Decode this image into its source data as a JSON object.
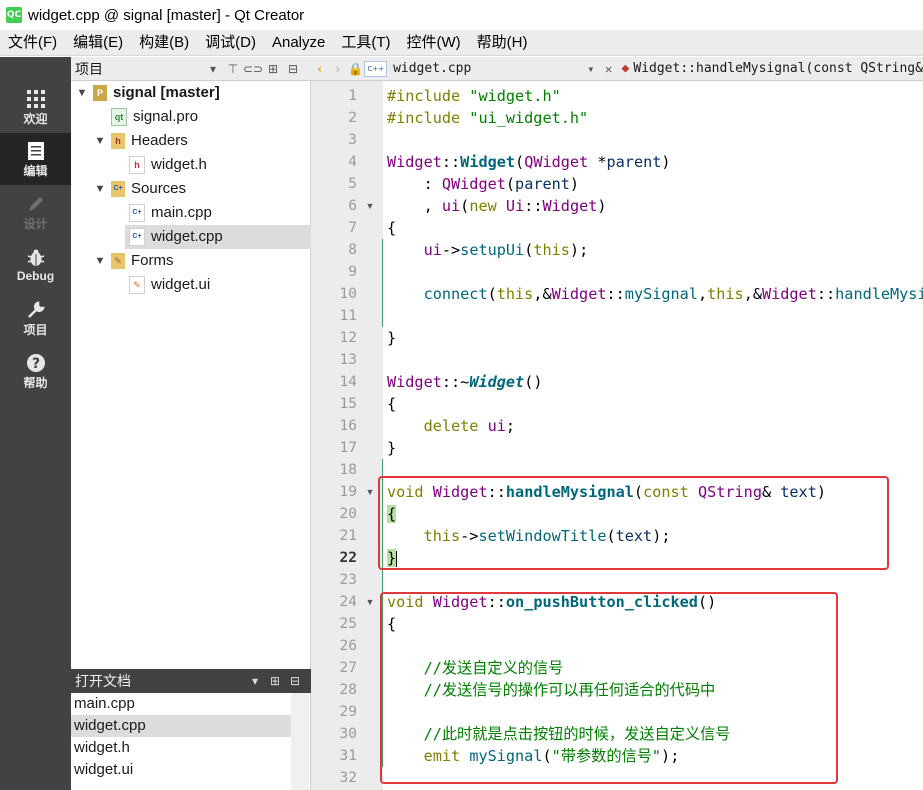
{
  "window": {
    "title": "widget.cpp @ signal [master] - Qt Creator",
    "app_icon": "QC"
  },
  "menu": [
    "文件(F)",
    "编辑(E)",
    "构建(B)",
    "调试(D)",
    "Analyze",
    "工具(T)",
    "控件(W)",
    "帮助(H)"
  ],
  "modes": [
    {
      "label": "欢迎",
      "icon": "grid-icon"
    },
    {
      "label": "编辑",
      "icon": "document-icon"
    },
    {
      "label": "设计",
      "icon": "pencil-icon"
    },
    {
      "label": "Debug",
      "icon": "bug-icon"
    },
    {
      "label": "项目",
      "icon": "wrench-icon"
    },
    {
      "label": "帮助",
      "icon": "help-icon"
    }
  ],
  "project_panel": {
    "title": "项目",
    "tree": [
      {
        "label": "signal [master]",
        "level": 0,
        "expanded": true,
        "type": "project"
      },
      {
        "label": "signal.pro",
        "level": 1,
        "type": "pro"
      },
      {
        "label": "Headers",
        "level": 1,
        "expanded": true,
        "type": "folder-h"
      },
      {
        "label": "widget.h",
        "level": 2,
        "type": "header"
      },
      {
        "label": "Sources",
        "level": 1,
        "expanded": true,
        "type": "folder-cpp"
      },
      {
        "label": "main.cpp",
        "level": 2,
        "type": "cpp"
      },
      {
        "label": "widget.cpp",
        "level": 2,
        "type": "cpp",
        "selected": true
      },
      {
        "label": "Forms",
        "level": 1,
        "expanded": true,
        "type": "folder-ui"
      },
      {
        "label": "widget.ui",
        "level": 2,
        "type": "ui"
      }
    ]
  },
  "open_docs": {
    "title": "打开文档",
    "items": [
      "main.cpp",
      "widget.cpp",
      "widget.h",
      "widget.ui"
    ],
    "selected": 1
  },
  "editor": {
    "file_tab": "widget.cpp",
    "file_tab_icon": "C++",
    "symbol": "Widget::handleMysignal(const QString&",
    "current_line": 22,
    "lines": [
      "1",
      "2",
      "3",
      "4",
      "5",
      "6",
      "7",
      "8",
      "9",
      "10",
      "11",
      "12",
      "13",
      "14",
      "15",
      "16",
      "17",
      "18",
      "19",
      "20",
      "21",
      "22",
      "23",
      "24",
      "25",
      "26",
      "27",
      "28",
      "29",
      "30",
      "31",
      "32"
    ],
    "code": {
      "l1_a": "#include ",
      "l1_b": "\"widget.h\"",
      "l2_a": "#include ",
      "l2_b": "\"ui_widget.h\"",
      "l4_cls": "Widget",
      "l4_sep": "::",
      "l4_fn": "Widget",
      "l4_p1": "(",
      "l4_type": "QWidget",
      "l4_p2": " *",
      "l4_arg": "parent",
      "l4_p3": ")",
      "l5_a": "    : ",
      "l5_cls": "QWidget",
      "l5_b": "(",
      "l5_arg": "parent",
      "l5_c": ")",
      "l6_a": "    , ",
      "l6_var": "ui",
      "l6_b": "(",
      "l6_kw": "new",
      "l6_c": " ",
      "l6_cls": "Ui",
      "l6_d": "::",
      "l6_cls2": "Widget",
      "l6_e": ")",
      "l7": "{",
      "l8_a": "    ",
      "l8_var": "ui",
      "l8_b": "->",
      "l8_fn": "setupUi",
      "l8_c": "(",
      "l8_kw": "this",
      "l8_d": ");",
      "l10_a": "    ",
      "l10_fn": "connect",
      "l10_b": "(",
      "l10_kw": "this",
      "l10_c": ",&",
      "l10_cls": "Widget",
      "l10_d": "::",
      "l10_fn2": "mySignal",
      "l10_e": ",",
      "l10_kw2": "this",
      "l10_f": ",&",
      "l10_cls2": "Widget",
      "l10_g": "::",
      "l10_fn3": "handleMysignal);",
      "l12": "}",
      "l14_cls": "Widget",
      "l14_sep": "::~",
      "l14_fn": "Widget",
      "l14_p": "()",
      "l15": "{",
      "l16_a": "    ",
      "l16_kw": "delete",
      "l16_b": " ",
      "l16_var": "ui",
      "l16_c": ";",
      "l17": "}",
      "l19_kw": "void",
      "l19_a": " ",
      "l19_cls": "Widget",
      "l19_sep": "::",
      "l19_fn": "handleMysignal",
      "l19_b": "(",
      "l19_kw2": "const",
      "l19_c": " ",
      "l19_cls2": "QString",
      "l19_d": "& ",
      "l19_arg": "text",
      "l19_e": ")",
      "l20": "{",
      "l21_a": "    ",
      "l21_kw": "this",
      "l21_b": "->",
      "l21_fn": "setWindowTitle",
      "l21_c": "(",
      "l21_arg": "text",
      "l21_d": ");",
      "l22": "}",
      "l24_kw": "void",
      "l24_a": " ",
      "l24_cls": "Widget",
      "l24_sep": "::",
      "l24_fn": "on_pushButton_clicked",
      "l24_b": "()",
      "l25": "{",
      "l27": "    //发送自定义的信号",
      "l28": "    //发送信号的操作可以再任何适合的代码中",
      "l30": "    //此时就是点击按钮的时候，发送自定义信号",
      "l31_a": "    ",
      "l31_kw": "emit",
      "l31_b": " ",
      "l31_fn": "mySignal",
      "l31_c": "(",
      "l31_str": "\"带参数的信号\"",
      "l31_d": ");"
    }
  },
  "colors": {
    "highlight_box": "#e0393b",
    "modebar": "#404244"
  }
}
